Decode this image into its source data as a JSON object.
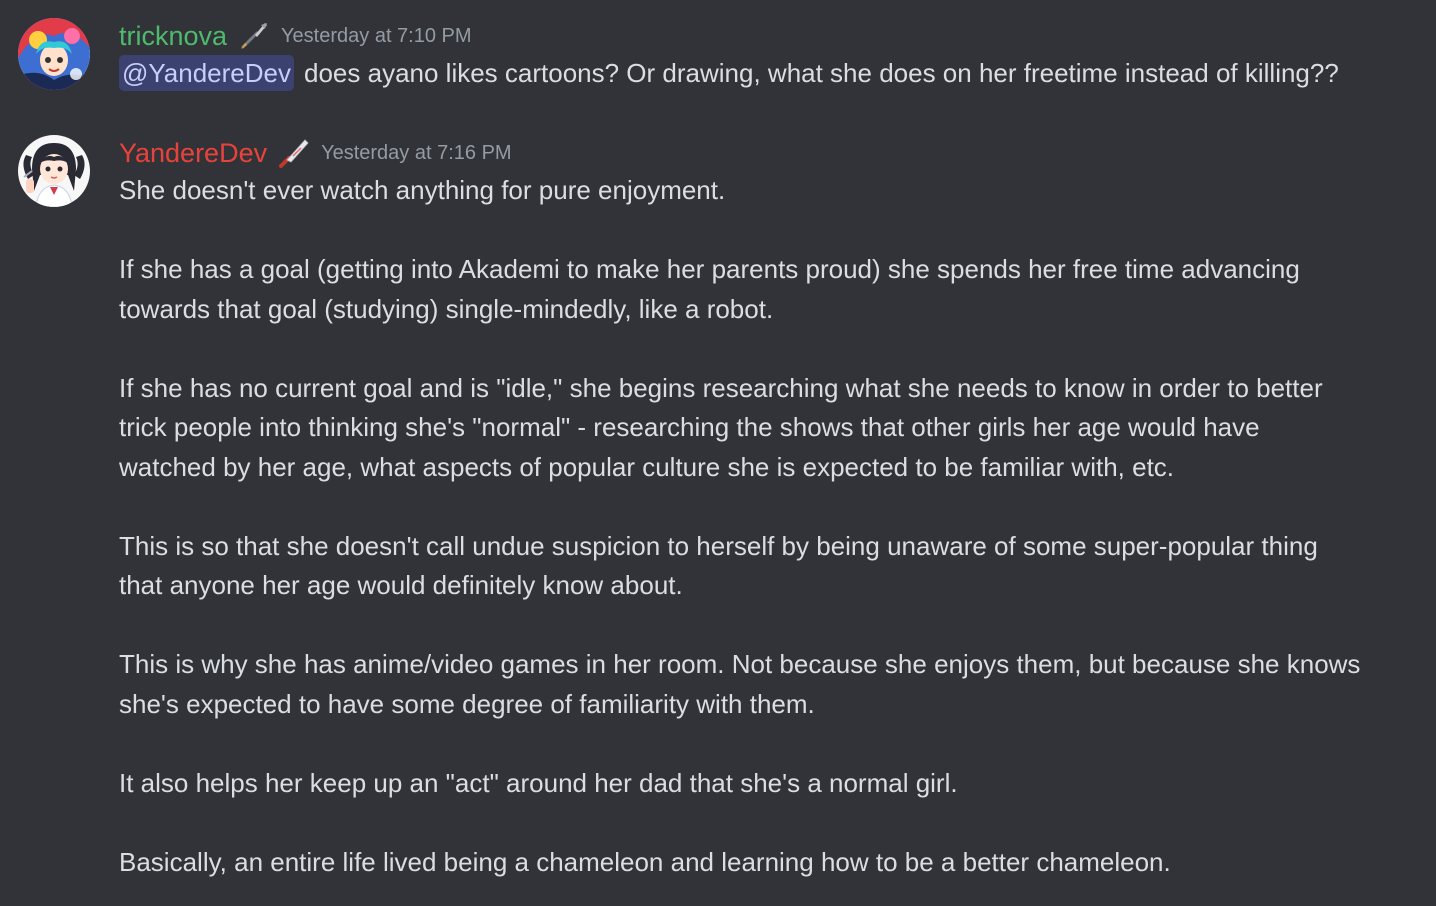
{
  "messages": [
    {
      "author": "tricknova",
      "author_color": "#4dbb6c",
      "timestamp": "Yesterday at 7:10 PM",
      "avatar_icon": "anime-avatar-icon",
      "role_icon": "rocket-icon",
      "mention": "@YandereDev",
      "text": "does ayano likes cartoons? Or drawing, what she does on her freetime instead of killing??"
    },
    {
      "author": "YandereDev",
      "author_color": "#e8433b",
      "timestamp": "Yesterday at 7:16 PM",
      "avatar_icon": "anime-girl-avatar-icon",
      "role_icon": "knife-icon",
      "paragraphs": [
        [
          "She doesn't ever watch anything for pure enjoyment."
        ],
        [
          "If she has a goal (getting into Akademi to make her parents proud) she spends her free time advancing",
          "towards that goal (studying) single-mindedly, like a robot."
        ],
        [
          "If she has no current goal and is \"idle,\" she begins researching what she needs to know in order to better",
          "trick people into thinking she's \"normal\" - researching the shows that other girls her age would have",
          "watched by her age, what aspects of popular culture she is expected to be familiar with, etc."
        ],
        [
          "This is so that she doesn't call undue suspicion to herself  by being unaware of some super-popular thing",
          "that anyone her age would definitely know about."
        ],
        [
          "This is why she has anime/video games in her room. Not because she enjoys them, but because she knows",
          "she's expected to have some degree of familiarity with them."
        ],
        [
          "It also helps her keep up an \"act\" around her dad that she's a normal girl."
        ],
        [
          "Basically, an entire life lived being a chameleon and learning how to be a better chameleon."
        ]
      ]
    }
  ]
}
